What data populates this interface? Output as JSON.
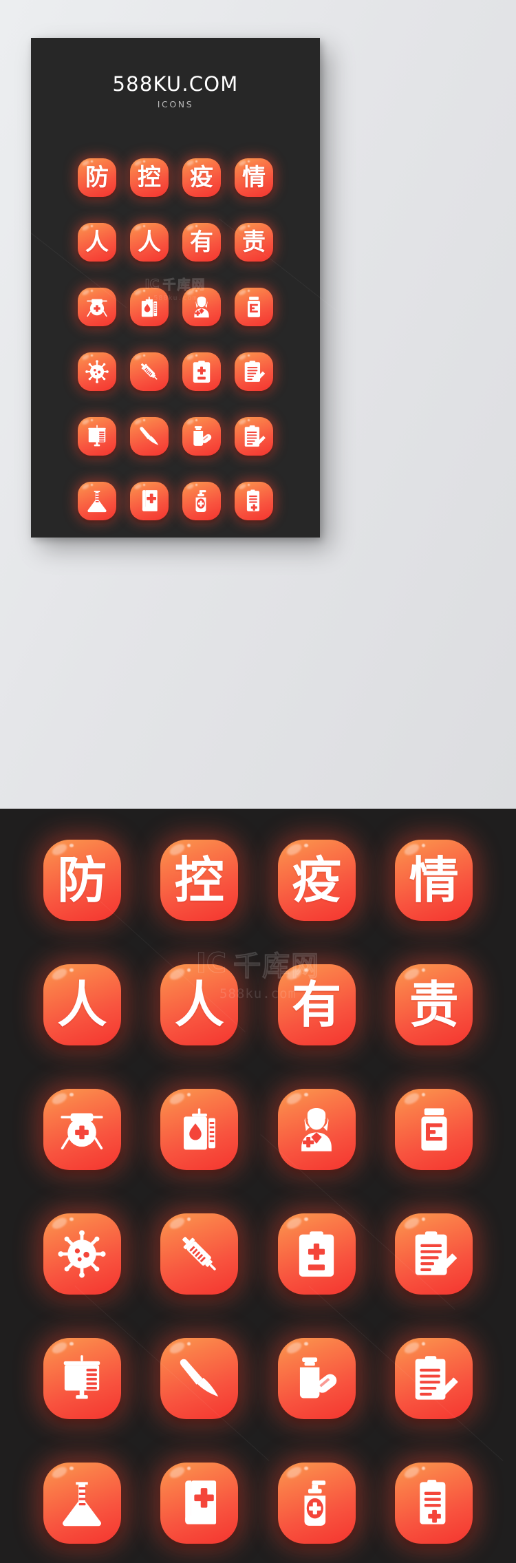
{
  "brand": {
    "title": "588KU.COM",
    "subtitle": "ICONS"
  },
  "watermark": {
    "mark": "IC",
    "site_cn": "千库网",
    "url": "588ku.com"
  },
  "theme": {
    "page_background": "#e7e8ea",
    "panel_background": "#1f1e1e",
    "card_background": "#272727",
    "tile_gradient_start": "#fb9a4e",
    "tile_gradient_end": "#f4352f",
    "glyph_color": "#ffffff",
    "glow_color": "#f84632"
  },
  "icons": [
    {
      "name": "character-fang",
      "kind": "text",
      "glyph": "防",
      "label": "防"
    },
    {
      "name": "character-kong",
      "kind": "text",
      "glyph": "控",
      "label": "控"
    },
    {
      "name": "character-yi",
      "kind": "text",
      "glyph": "疫",
      "label": "疫"
    },
    {
      "name": "character-qing",
      "kind": "text",
      "glyph": "情",
      "label": "情"
    },
    {
      "name": "character-ren-1",
      "kind": "text",
      "glyph": "人",
      "label": "人"
    },
    {
      "name": "character-ren-2",
      "kind": "text",
      "glyph": "人",
      "label": "人"
    },
    {
      "name": "character-you",
      "kind": "text",
      "glyph": "有",
      "label": "有"
    },
    {
      "name": "character-ze",
      "kind": "text",
      "glyph": "责",
      "label": "责"
    },
    {
      "name": "nurse-cap-icon",
      "kind": "svg",
      "svg": "nursecap",
      "label": "护士帽"
    },
    {
      "name": "blood-bag-icon",
      "kind": "svg",
      "svg": "bloodbag",
      "label": "血袋"
    },
    {
      "name": "nurse-person-icon",
      "kind": "svg",
      "svg": "nurse",
      "label": "护士"
    },
    {
      "name": "pill-bottle-icon",
      "kind": "svg",
      "svg": "pillbottle",
      "label": "药瓶"
    },
    {
      "name": "virus-icon",
      "kind": "svg",
      "svg": "virus",
      "label": "病毒"
    },
    {
      "name": "syringe-icon",
      "kind": "svg",
      "svg": "syringe",
      "label": "注射器"
    },
    {
      "name": "medical-clipboard-icon",
      "kind": "svg",
      "svg": "clipcross",
      "label": "病历板"
    },
    {
      "name": "clipboard-pencil-icon",
      "kind": "svg",
      "svg": "clippencil",
      "label": "病历记录"
    },
    {
      "name": "iv-drip-icon",
      "kind": "svg",
      "svg": "ivdrip",
      "label": "输液袋"
    },
    {
      "name": "scalpel-icon",
      "kind": "svg",
      "svg": "scalpel",
      "label": "手术刀"
    },
    {
      "name": "capsule-bottle-icon",
      "kind": "svg",
      "svg": "capsule",
      "label": "胶囊药瓶"
    },
    {
      "name": "notepad-pen-icon",
      "kind": "svg",
      "svg": "notepad",
      "label": "记录本"
    },
    {
      "name": "flask-icon",
      "kind": "svg",
      "svg": "flask",
      "label": "烧瓶"
    },
    {
      "name": "medical-book-icon",
      "kind": "svg",
      "svg": "book",
      "label": "医学书"
    },
    {
      "name": "sanitizer-bottle-icon",
      "kind": "svg",
      "svg": "sanitizer",
      "label": "消毒液"
    },
    {
      "name": "medical-record-icon",
      "kind": "svg",
      "svg": "record",
      "label": "病历单"
    }
  ]
}
